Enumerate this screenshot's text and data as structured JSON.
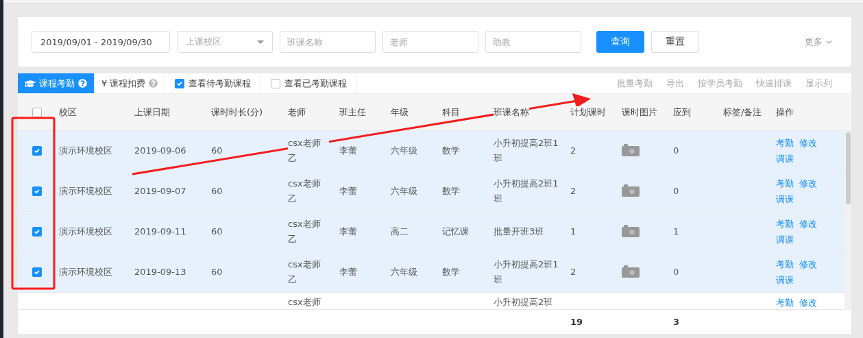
{
  "filters": {
    "date_range": "2019/09/01 - 2019/09/30",
    "campus": {
      "placeholder": "上课校区"
    },
    "class_name": {
      "placeholder": "班课名称"
    },
    "teacher": {
      "placeholder": "老师"
    },
    "assistant": {
      "placeholder": "助教"
    },
    "query_button": "查询",
    "reset_button": "重置",
    "more": "更多"
  },
  "tabs": [
    {
      "label": "课程考勤",
      "selected": true
    },
    {
      "label": "¥ 课程扣费",
      "selected": false
    }
  ],
  "view_checks": [
    {
      "label": "查看待考勤课程",
      "checked": true
    },
    {
      "label": "查看已考勤课程",
      "checked": false
    }
  ],
  "actions": [
    "批量考勤",
    "导出",
    "按学员考勤",
    "快速排课",
    "显示列"
  ],
  "table": {
    "header_checked": false,
    "columns": [
      "校区",
      "上课日期",
      "课时时长(分)",
      "老师",
      "班主任",
      "年级",
      "科目",
      "班课名称",
      "计划课时",
      "课时图片",
      "应到",
      "标签/备注",
      "操作"
    ],
    "rows": [
      {
        "kind": "full",
        "checked": true,
        "campus": "演示环境校区",
        "date": "2019-09-06",
        "duration": "60",
        "teacher": "csx老师乙",
        "head_teacher": "李蕾",
        "grade": "六年级",
        "subject": "数学",
        "class_name": "小升初提高2班1班",
        "planned": "2",
        "expected": "0",
        "actions": [
          "考勤",
          "修改",
          "调课"
        ]
      },
      {
        "kind": "full",
        "checked": true,
        "campus": "演示环境校区",
        "date": "2019-09-07",
        "duration": "60",
        "teacher": "csx老师乙",
        "head_teacher": "李蕾",
        "grade": "六年级",
        "subject": "数学",
        "class_name": "小升初提高2班1班",
        "planned": "2",
        "expected": "0",
        "actions": [
          "考勤",
          "修改",
          "调课"
        ]
      },
      {
        "kind": "full",
        "checked": true,
        "campus": "演示环境校区",
        "date": "2019-09-11",
        "duration": "60",
        "teacher": "csx老师乙",
        "head_teacher": "李蕾",
        "grade": "高二",
        "subject": "记忆课",
        "class_name": "批量开班3班",
        "planned": "1",
        "expected": "1",
        "actions": [
          "考勤",
          "修改",
          "调课"
        ]
      },
      {
        "kind": "full",
        "checked": true,
        "campus": "演示环境校区",
        "date": "2019-09-13",
        "duration": "60",
        "teacher": "csx老师乙",
        "head_teacher": "李蕾",
        "grade": "六年级",
        "subject": "数学",
        "class_name": "小升初提高2班1班",
        "planned": "2",
        "expected": "0",
        "actions": [
          "考勤",
          "修改",
          "调课"
        ]
      },
      {
        "kind": "partial",
        "checked": false,
        "teacher": "csx老师",
        "class_name": "小升初提高2班",
        "actions": [
          "考勤",
          "修改"
        ]
      }
    ],
    "totals": {
      "planned": "19",
      "expected": "3"
    }
  }
}
